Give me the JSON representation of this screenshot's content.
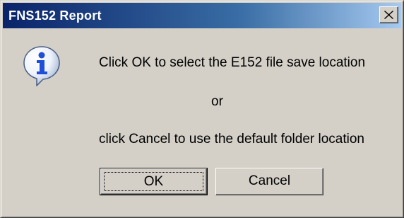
{
  "window": {
    "title": "FNS152 Report"
  },
  "dialog": {
    "icon": "information-icon",
    "message_line1": "Click OK to select the E152 file save location",
    "message_or": "or",
    "message_line3": "click Cancel to use the default folder location"
  },
  "buttons": {
    "ok_label": "OK",
    "cancel_label": "Cancel"
  },
  "colors": {
    "titlebar_start": "#0a246a",
    "titlebar_end": "#a6caf0",
    "face": "#d4d0c8"
  }
}
